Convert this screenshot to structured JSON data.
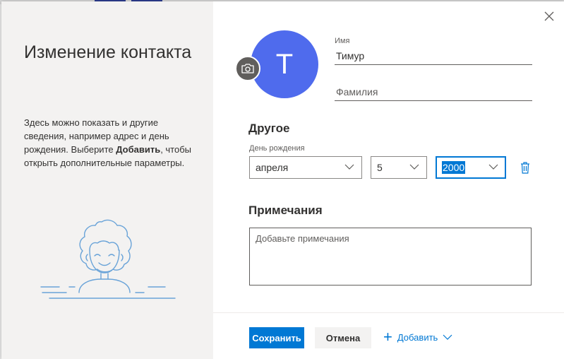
{
  "dialog": {
    "title": "Изменение контакта",
    "help": {
      "before": "Здесь можно показать и другие сведения, например адрес и день рождения. Выберите ",
      "bold": "Добавить",
      "after": ", чтобы открыть дополнительные параметры."
    }
  },
  "avatar": {
    "initial": "T",
    "color": "#4f6bed"
  },
  "fields": {
    "first_name_label": "Имя",
    "first_name_value": "Тимур",
    "last_name_placeholder": "Фамилия"
  },
  "other": {
    "heading": "Другое",
    "birthday_label": "День рождения",
    "month": "апреля",
    "day": "5",
    "year": "2000"
  },
  "notes": {
    "heading": "Примечания",
    "placeholder": "Добавьте примечания"
  },
  "footer": {
    "save": "Сохранить",
    "cancel": "Отмена",
    "add": "Добавить"
  },
  "colors": {
    "accent": "#0078d4",
    "panel": "#f3f2f1"
  }
}
